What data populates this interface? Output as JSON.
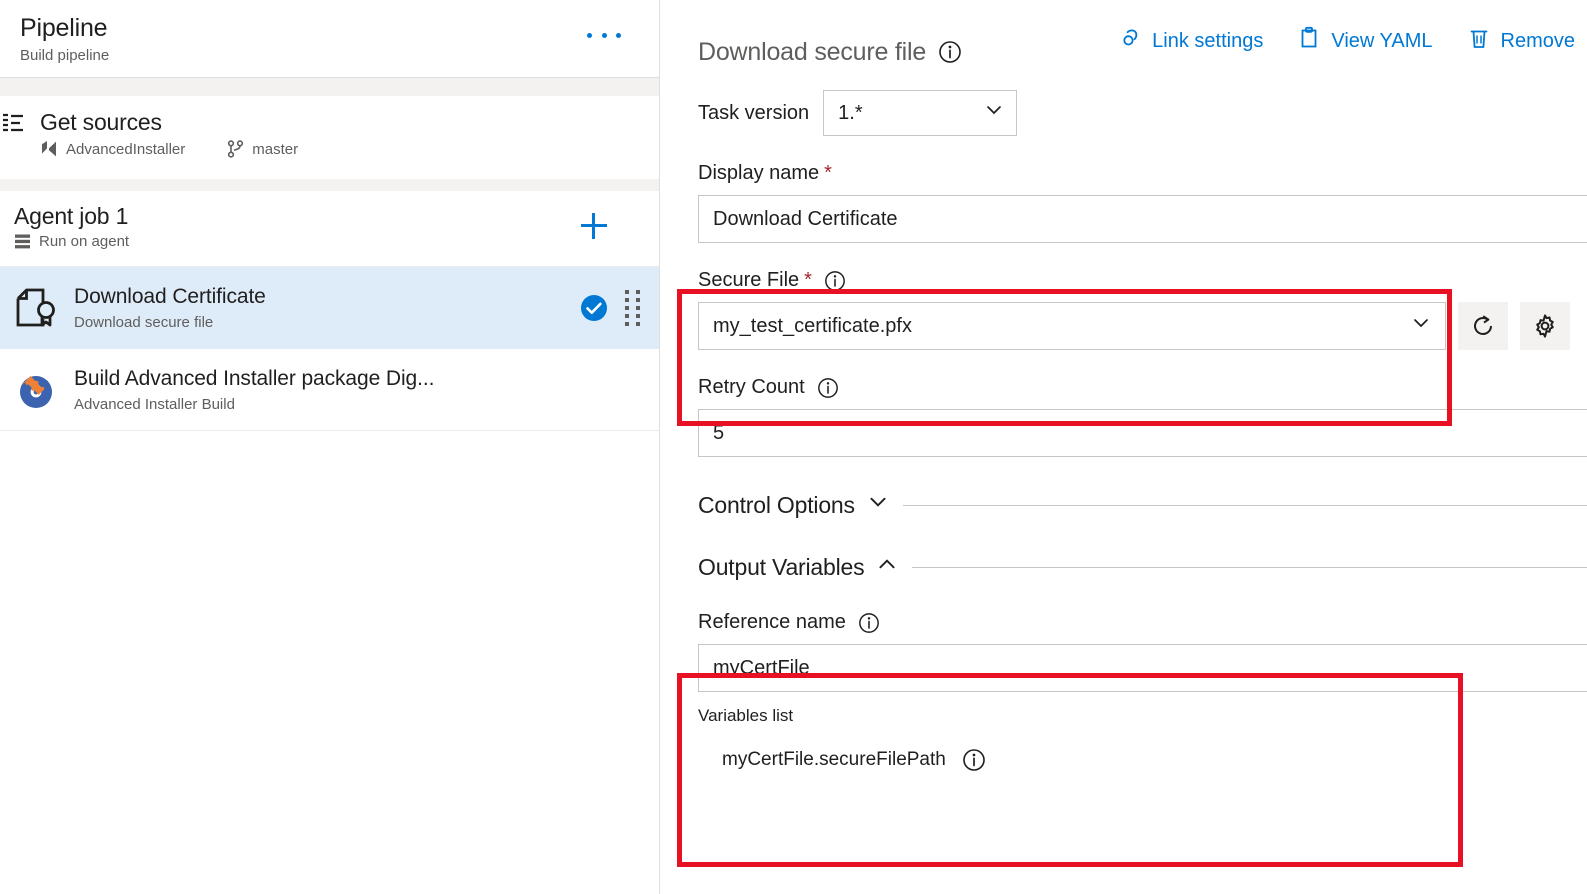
{
  "left_panel": {
    "pipeline": {
      "title": "Pipeline",
      "subtitle": "Build pipeline",
      "more_menu": "..."
    },
    "get_sources": {
      "title": "Get sources",
      "repository": "AdvancedInstaller",
      "branch": "master"
    },
    "agent_job": {
      "title": "Agent job 1",
      "subtitle": "Run on agent",
      "add_label": "+"
    },
    "tasks": [
      {
        "name": "Download Certificate",
        "subtitle": "Download secure file",
        "selected": true,
        "status": "enabled"
      },
      {
        "name": "Build Advanced Installer package Dig...",
        "subtitle": "Advanced Installer Build",
        "selected": false,
        "status": "none"
      }
    ]
  },
  "right_panel": {
    "title": "Download secure file",
    "actions": [
      {
        "label": "Link settings",
        "icon": "link-icon"
      },
      {
        "label": "View YAML",
        "icon": "clipboard-icon"
      },
      {
        "label": "Remove",
        "icon": "trash-icon"
      }
    ],
    "task_version": {
      "label": "Task version",
      "value": "1.*"
    },
    "display_name": {
      "label": "Display name",
      "required": "*",
      "value": "Download Certificate"
    },
    "secure_file": {
      "label": "Secure File",
      "required": "*",
      "value": "my_test_certificate.pfx",
      "refresh_title": "Refresh",
      "manage_title": "Manage"
    },
    "retry_count": {
      "label": "Retry Count",
      "value": "5"
    },
    "control_options": {
      "label": "Control Options",
      "expanded": false
    },
    "output_variables": {
      "label": "Output Variables",
      "expanded": true,
      "reference_name": {
        "label": "Reference name",
        "value": "myCertFile"
      },
      "variables_list_label": "Variables list",
      "variables": [
        {
          "name": "myCertFile.secureFilePath"
        }
      ]
    }
  },
  "colors": {
    "accent": "#0078d4",
    "selection": "#deecf9",
    "annotation": "#e81123",
    "required": "#a4262c",
    "border": "#c8c6c4",
    "muted_text": "#605e5c"
  }
}
